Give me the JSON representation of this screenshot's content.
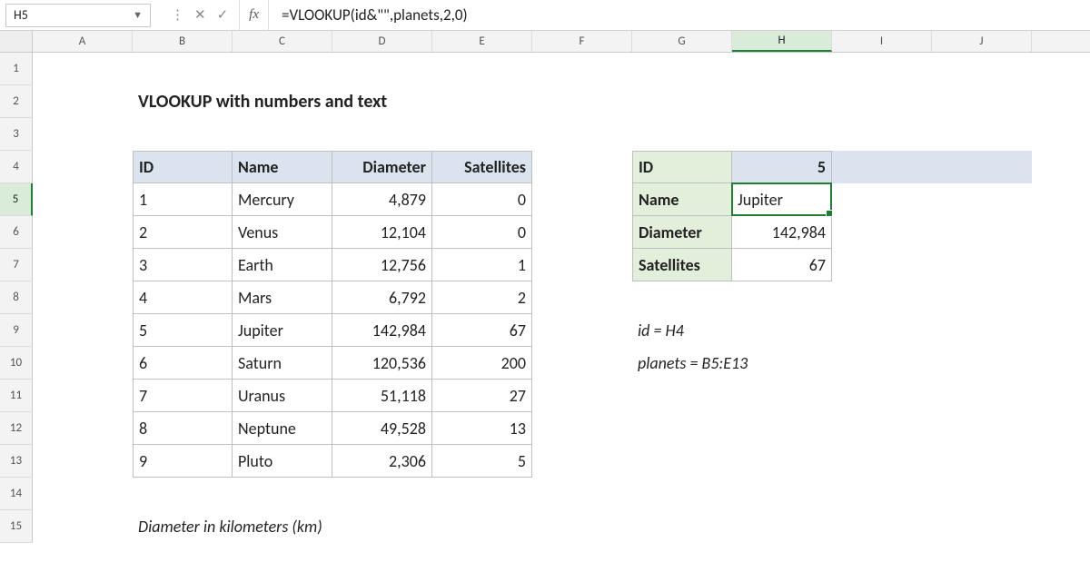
{
  "name_box": "H5",
  "fx_label": "fx",
  "formula": "=VLOOKUP(id&\"\",planets,2,0)",
  "col_labels": [
    "A",
    "B",
    "C",
    "D",
    "E",
    "F",
    "G",
    "H",
    "I",
    "J"
  ],
  "row_labels": [
    "1",
    "2",
    "3",
    "4",
    "5",
    "6",
    "7",
    "8",
    "9",
    "10",
    "11",
    "12",
    "13",
    "14",
    "15"
  ],
  "title": "VLOOKUP with numbers and text",
  "headers": {
    "id": "ID",
    "name": "Name",
    "diameter": "Diameter",
    "satellites": "Satellites"
  },
  "planets": [
    {
      "id": "1",
      "name": "Mercury",
      "diameter": "4,879",
      "satellites": "0"
    },
    {
      "id": "2",
      "name": "Venus",
      "diameter": "12,104",
      "satellites": "0"
    },
    {
      "id": "3",
      "name": "Earth",
      "diameter": "12,756",
      "satellites": "1"
    },
    {
      "id": "4",
      "name": "Mars",
      "diameter": "6,792",
      "satellites": "2"
    },
    {
      "id": "5",
      "name": "Jupiter",
      "diameter": "142,984",
      "satellites": "67"
    },
    {
      "id": "6",
      "name": "Saturn",
      "diameter": "120,536",
      "satellites": "200"
    },
    {
      "id": "7",
      "name": "Uranus",
      "diameter": "51,118",
      "satellites": "27"
    },
    {
      "id": "8",
      "name": "Neptune",
      "diameter": "49,528",
      "satellites": "13"
    },
    {
      "id": "9",
      "name": "Pluto",
      "diameter": "2,306",
      "satellites": "5"
    }
  ],
  "lookup": {
    "labels": {
      "id": "ID",
      "name": "Name",
      "diameter": "Diameter",
      "satellites": "Satellites"
    },
    "values": {
      "id": "5",
      "name": "Jupiter",
      "diameter": "142,984",
      "satellites": "67"
    }
  },
  "notes": {
    "id_def": "id = H4",
    "planets_def": "planets = B5:E13",
    "footer": "Diameter in kilometers (km)"
  },
  "colors": {
    "table_header_bg": "#dbe3ee",
    "lookup_label_bg": "#e2efdb",
    "selection_green": "#1e7e34"
  }
}
